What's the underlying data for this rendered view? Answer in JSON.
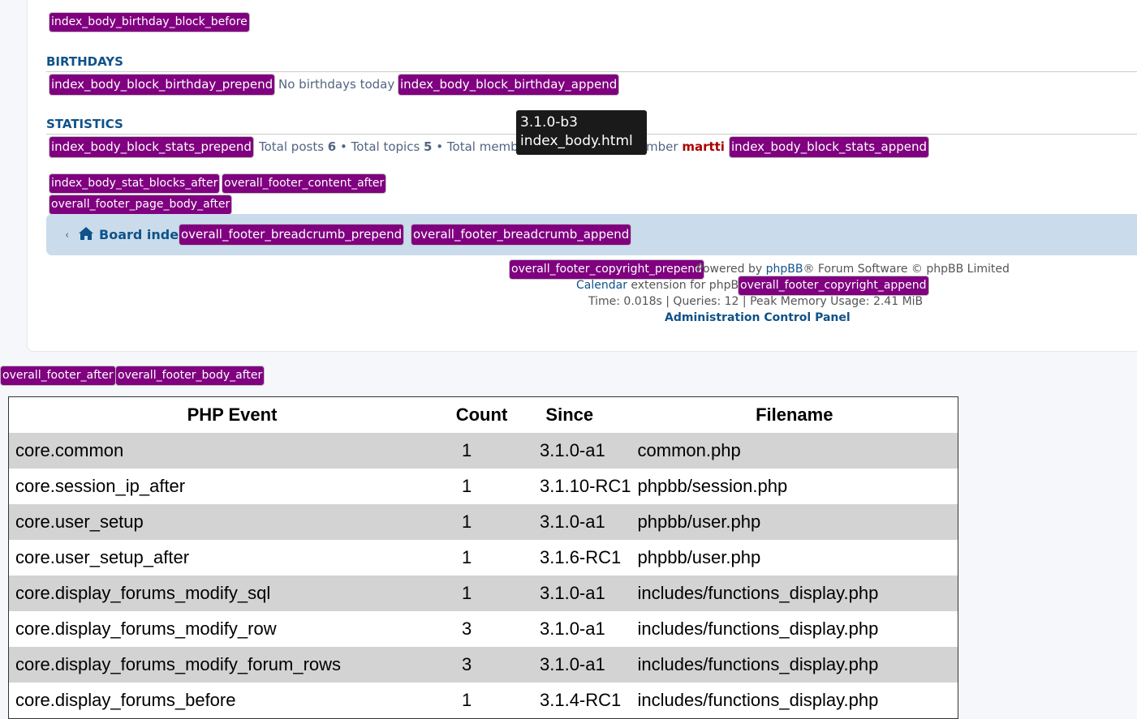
{
  "templates": {
    "birthday_block_before": "index_body_birthday_block_before",
    "birthday_prepend": "index_body_block_birthday_prepend",
    "birthday_append": "index_body_block_birthday_append",
    "stats_prepend": "index_body_block_stats_prepend",
    "stats_append": "index_body_block_stats_append",
    "stat_blocks_after": "index_body_stat_blocks_after",
    "footer_content_after": "overall_footer_content_after",
    "footer_page_body_after": "overall_footer_page_body_after",
    "footer_breadcrumb_prepend": "overall_footer_breadcrumb_prepend",
    "footer_breadcrumb_append": "overall_footer_breadcrumb_append",
    "footer_copyright_prepend": "overall_footer_copyright_prepend",
    "footer_copyright_append": "overall_footer_copyright_append",
    "footer_after": "overall_footer_after",
    "footer_body_after": "overall_footer_body_after"
  },
  "birthdays": {
    "heading": "Birthdays",
    "text": "No birthdays today"
  },
  "statistics": {
    "heading": "Statistics",
    "posts_label": "Total posts",
    "posts_value": "6",
    "bullet1": "•",
    "topics_label": "Total topics",
    "topics_value": "5",
    "bullet2": "•",
    "members_label": "Total memb",
    "member_suffix": "mber",
    "newest_member": "martti"
  },
  "tooltip": {
    "version": "3.1.0-b3",
    "file": "index_body.html"
  },
  "breadcrumb": {
    "home_label": "Board index",
    "chevron": "‹"
  },
  "footer": {
    "powered_prefix": "Powered by",
    "powered_link": "phpBB",
    "powered_suffix": "® Forum Software © phpBB Limited",
    "calendar_link": "Calendar",
    "calendar_suffix": "extension for phpBB",
    "stats_line": "Time: 0.018s | Queries: 12 | Peak Memory Usage: 2.41 MiB",
    "acp_link": "Administration Control Panel"
  },
  "events_table": {
    "headers": [
      "PHP Event",
      "Count",
      "Since",
      "Filename"
    ],
    "rows": [
      {
        "event": "core.common",
        "count": "1",
        "since": "3.1.0-a1",
        "file": "common.php"
      },
      {
        "event": "core.session_ip_after",
        "count": "1",
        "since": "3.1.10-RC1",
        "file": "phpbb/session.php"
      },
      {
        "event": "core.user_setup",
        "count": "1",
        "since": "3.1.0-a1",
        "file": "phpbb/user.php"
      },
      {
        "event": "core.user_setup_after",
        "count": "1",
        "since": "3.1.6-RC1",
        "file": "phpbb/user.php"
      },
      {
        "event": "core.display_forums_modify_sql",
        "count": "1",
        "since": "3.1.0-a1",
        "file": "includes/functions_display.php"
      },
      {
        "event": "core.display_forums_modify_row",
        "count": "3",
        "since": "3.1.0-a1",
        "file": "includes/functions_display.php"
      },
      {
        "event": "core.display_forums_modify_forum_rows",
        "count": "3",
        "since": "3.1.0-a1",
        "file": "includes/functions_display.php"
      },
      {
        "event": "core.display_forums_before",
        "count": "1",
        "since": "3.1.4-RC1",
        "file": "includes/functions_display.php"
      }
    ]
  },
  "colors": {
    "tag_bg": "#800080",
    "link": "#105289",
    "username": "#aa0000",
    "navbar": "#cadceb",
    "row_alt": "#d3d3d3"
  }
}
